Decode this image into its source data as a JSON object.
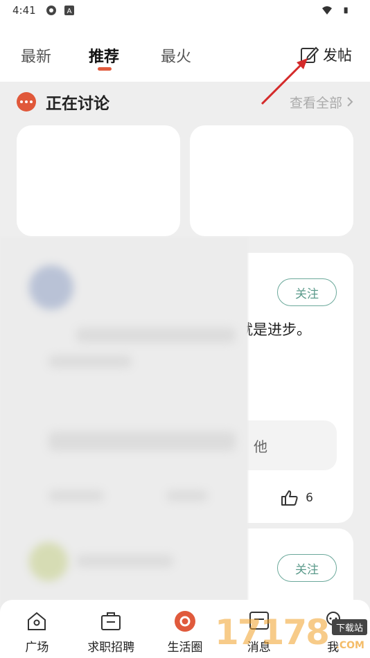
{
  "status_bar": {
    "time": "4:41"
  },
  "top_tabs": [
    {
      "label": "最新",
      "active": false
    },
    {
      "label": "推荐",
      "active": true
    },
    {
      "label": "最火",
      "active": false
    }
  ],
  "post_button": {
    "label": "发帖",
    "icon": "edit-icon"
  },
  "discussion": {
    "title": "正在讨论",
    "view_all": "查看全部"
  },
  "feed": [
    {
      "follow_label": "关注",
      "text_fragment": "就是进步。",
      "reply_fragment": "他",
      "like_count": "6"
    },
    {
      "follow_label": "关注",
      "text_fragment": ""
    }
  ],
  "bottom_nav": [
    {
      "label": "广场",
      "icon": "home-icon"
    },
    {
      "label": "求职招聘",
      "icon": "briefcase-icon"
    },
    {
      "label": "生活圈",
      "icon": "circle-icon",
      "active": true
    },
    {
      "label": "消息",
      "icon": "message-icon"
    },
    {
      "label": "我",
      "icon": "profile-icon"
    }
  ],
  "watermark": {
    "number": "17178",
    "tag": "下载站",
    "suffix": ".COM"
  },
  "colors": {
    "accent": "#e05a3c",
    "follow": "#5b9a8b"
  }
}
